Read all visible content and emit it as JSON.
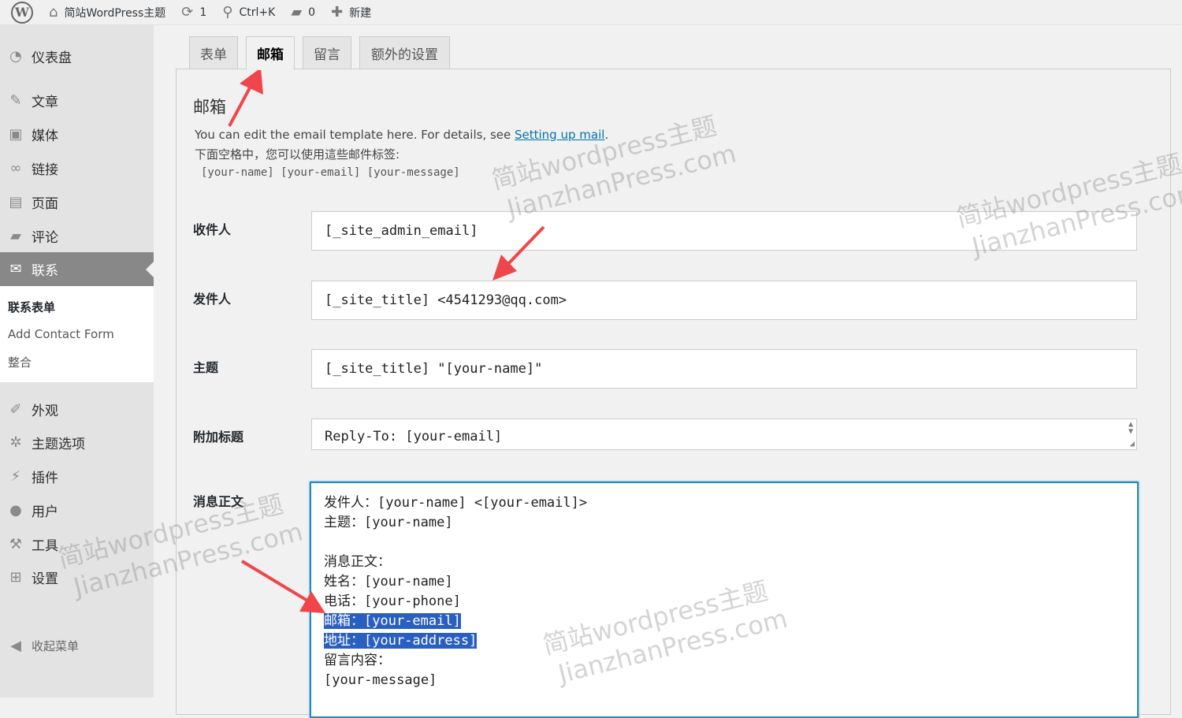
{
  "adminbar": {
    "site_name": "简站WordPress主题",
    "updates_count": "1",
    "search_shortcut": "Ctrl+K",
    "comments_count": "0",
    "new_label": "新建"
  },
  "sidebar": {
    "items": [
      {
        "label": "仪表盘",
        "icon": "dashboard-icon"
      },
      {
        "label": "文章",
        "icon": "pin-icon"
      },
      {
        "label": "媒体",
        "icon": "media-icon"
      },
      {
        "label": "链接",
        "icon": "link-icon"
      },
      {
        "label": "页面",
        "icon": "page-icon"
      },
      {
        "label": "评论",
        "icon": "comment-icon"
      },
      {
        "label": "联系",
        "icon": "mail-icon"
      },
      {
        "label": "外观",
        "icon": "brush-icon"
      },
      {
        "label": "主题选项",
        "icon": "gear-icon"
      },
      {
        "label": "插件",
        "icon": "plugin-icon"
      },
      {
        "label": "用户",
        "icon": "user-icon"
      },
      {
        "label": "工具",
        "icon": "wrench-icon"
      },
      {
        "label": "设置",
        "icon": "settings-icon"
      }
    ],
    "submenu": [
      "联系表单",
      "Add Contact Form",
      "整合"
    ],
    "collapse_label": "收起菜单"
  },
  "tabs": [
    "表单",
    "邮箱",
    "留言",
    "额外的设置"
  ],
  "mail": {
    "title": "邮箱",
    "desc_prefix": "You can edit the email template here. For details, see ",
    "desc_link": "Setting up mail",
    "desc_suffix": ".",
    "desc_line2": "下面空格中，您可以使用這些邮件标签:",
    "tags": "[your-name] [your-email] [your-message]",
    "fields": {
      "to_label": "收件人",
      "to_value": "[_site_admin_email]",
      "from_label": "发件人",
      "from_value": "[_site_title] <4541293@qq.com>",
      "subject_label": "主题",
      "subject_value": "[_site_title] \"[your-name]\"",
      "headers_label": "附加标题",
      "headers_value": "Reply-To: [your-email]",
      "body_label": "消息正文"
    },
    "body_lines": [
      "发件人：[your-name] <[your-email]>",
      "主题：[your-name]",
      "",
      "消息正文：",
      "姓名：[your-name]",
      "电话：[your-phone]",
      "邮箱：[your-email]",
      "地址：[your-address]",
      "留言内容：",
      "[your-message]"
    ]
  },
  "watermark": {
    "line1": "简站wordpress主题",
    "line2": "JianzhanPress.com"
  },
  "colors": {
    "accent": "#0073aa",
    "arrow": "#f0464b",
    "selection": "#2a5fc2",
    "focus_border": "#1e8cbe"
  }
}
